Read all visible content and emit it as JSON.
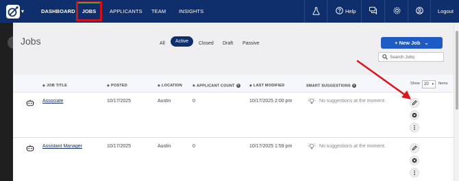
{
  "nav": {
    "items": [
      "DASHBOARD",
      "JOBS",
      "APPLICANTS",
      "TEAM",
      "INSIGHTS"
    ],
    "help": "Help",
    "logout": "Logout"
  },
  "page": {
    "title": "Jobs",
    "filters": [
      "All",
      "Active",
      "Closed",
      "Draft",
      "Passive"
    ],
    "new_job": "+ New Job",
    "search_placeholder": "Search Jobs"
  },
  "table": {
    "headers": {
      "title": "JOB TITLE",
      "posted": "POSTED",
      "location": "LOCATION",
      "count": "APPLICANT COUNT",
      "modified": "LAST MODIFIED",
      "smart": "SMART SUGGESTIONS"
    },
    "show_label": "Show",
    "show_value": "20",
    "items_label": "Items",
    "rows": [
      {
        "title": "Associate",
        "posted": "10/17/2025",
        "location": "Austin",
        "count": "0",
        "modified": "10/17/2025 2:00 pm",
        "suggestion": "No suggestions at the moment."
      },
      {
        "title": "Assistant Manager",
        "posted": "10/17/2025",
        "location": "Austin",
        "count": "0",
        "modified": "10/17/2025 1:59 pm",
        "suggestion": "No suggestions at the moment."
      }
    ]
  },
  "colors": {
    "nav_bg": "#0e2f6b",
    "highlight": "#d3121e",
    "primary_button": "#1e5bc6",
    "annotation_arrow": "#e0141e"
  }
}
